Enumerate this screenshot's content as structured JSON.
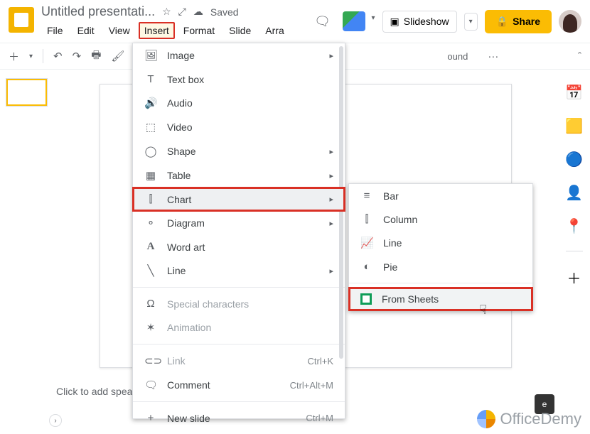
{
  "header": {
    "doc_title": "Untitled presentati...",
    "saved_label": "Saved",
    "comments_icon": "comments-icon",
    "slideshow_label": "Slideshow",
    "share_label": "Share"
  },
  "menubar": {
    "items": [
      "File",
      "Edit",
      "View",
      "Insert",
      "Format",
      "Slide",
      "Arra"
    ],
    "active_index": 3
  },
  "toolbar": {
    "background_trunc": "ound",
    "more": "···"
  },
  "insert_menu": {
    "items": [
      {
        "icon": "🖼",
        "label": "Image",
        "arrow": true
      },
      {
        "icon": "T",
        "label": "Text box"
      },
      {
        "icon": "🔊",
        "label": "Audio"
      },
      {
        "icon": "⬚",
        "label": "Video"
      },
      {
        "icon": "◯",
        "label": "Shape",
        "arrow": true
      },
      {
        "icon": "▦",
        "label": "Table",
        "arrow": true
      },
      {
        "icon": "⫿",
        "label": "Chart",
        "arrow": true,
        "highlight": true,
        "boxed": true
      },
      {
        "icon": "⚬",
        "label": "Diagram",
        "arrow": true
      },
      {
        "icon": "A",
        "label": "Word art"
      },
      {
        "icon": "╲",
        "label": "Line",
        "arrow": true
      }
    ],
    "group2": [
      {
        "icon": "Ω",
        "label": "Special characters",
        "disabled": true
      },
      {
        "icon": "✶",
        "label": "Animation",
        "disabled": true
      }
    ],
    "group3": [
      {
        "icon": "⊂⊃",
        "label": "Link",
        "shortcut": "Ctrl+K",
        "disabled": true
      },
      {
        "icon": "🗨",
        "label": "Comment",
        "shortcut": "Ctrl+Alt+M"
      }
    ],
    "group4": [
      {
        "icon": "+",
        "label": "New slide",
        "shortcut": "Ctrl+M"
      }
    ]
  },
  "chart_submenu": {
    "items": [
      {
        "icon": "≡",
        "label": "Bar"
      },
      {
        "icon": "⫿",
        "label": "Column"
      },
      {
        "icon": "📈",
        "label": "Line"
      },
      {
        "icon": "◐",
        "label": "Pie"
      }
    ],
    "from_sheets": {
      "label": "From Sheets",
      "hover": true,
      "boxed": true
    }
  },
  "speaker_notes": "Click to add speaker no",
  "sidepanel": {
    "icons": [
      {
        "name": "calendar-icon",
        "glyph": "📅"
      },
      {
        "name": "keep-icon",
        "glyph": "🟨"
      },
      {
        "name": "tasks-icon",
        "glyph": "🔵"
      },
      {
        "name": "contacts-icon",
        "glyph": "👤"
      },
      {
        "name": "maps-icon",
        "glyph": "📍"
      }
    ],
    "plus": "＋"
  },
  "watermark": {
    "text": "OfficeDemy"
  },
  "explore_label": "e"
}
